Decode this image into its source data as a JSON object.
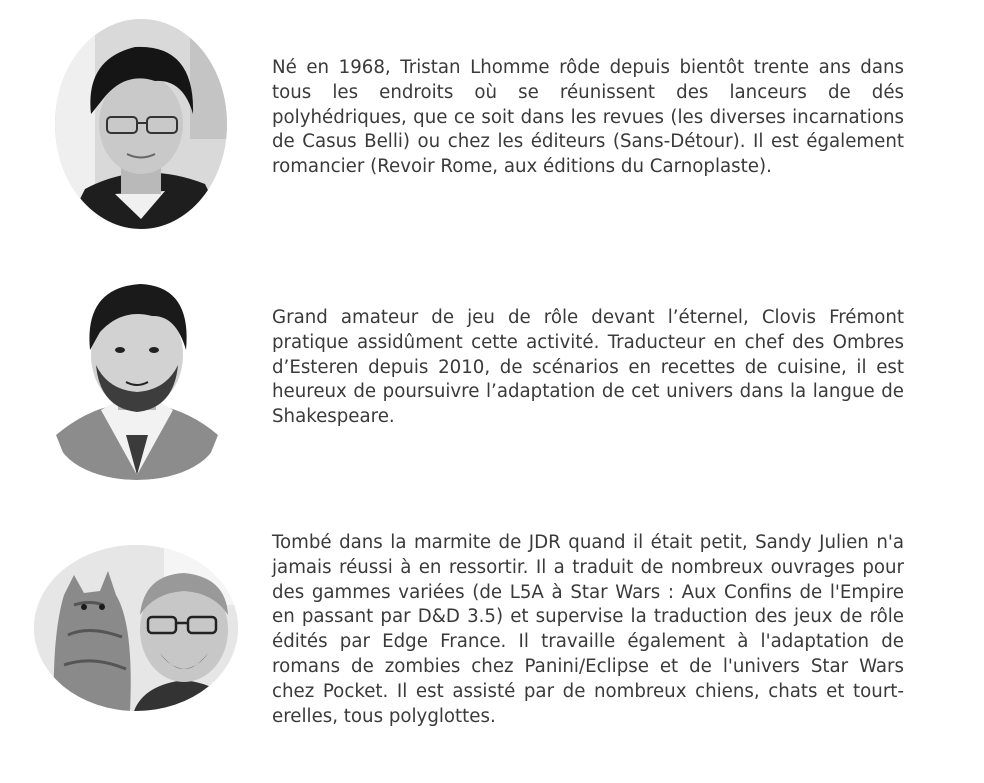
{
  "bios": [
    {
      "portrait_icon": "person-portrait-icon",
      "text": "Né en 1968, Tristan Lhomme rôde depuis bientôt trente ans dans tous les endroits où se réunissent des lanceurs de dés polyhédriques, que ce soit dans les revues (les diverses incarnations de Casus Belli) ou chez les éditeurs (Sans-Détour). Il est également romancier (Revoir Rome, aux éditions du Carnoplaste)."
    },
    {
      "portrait_icon": "person-portrait-icon",
      "text": "Grand amateur de jeu de rôle devant l’éternel, Clovis Frémont pratique assidûment cette activité. Traducteur en chef des Ombres d’Esteren depuis 2010, de scénarios en recettes de cuisine, il est heureux de poursuivre l’adaptation de cet univers dans la langue de Shakespeare."
    },
    {
      "portrait_icon": "person-with-cat-portrait-icon",
      "text": "Tombé dans la marmite de JDR quand il était petit, Sandy Julien n'a jamais réussi à en ressortir. Il a traduit de nombreux ouvrages pour des gammes variées (de L5A à Star Wars : Aux Confins de l'Empire en passant par D&D 3.5) et supervise la traduction des jeux de rôle édités par Edge France. Il travaille également à l'adaptation de romans de zombies chez Panini/Eclipse et de l'univers Star Wars chez Pocket. Il est assisté par de nombreux chiens, chats et tourt-erelles, tous polyglottes."
    }
  ]
}
